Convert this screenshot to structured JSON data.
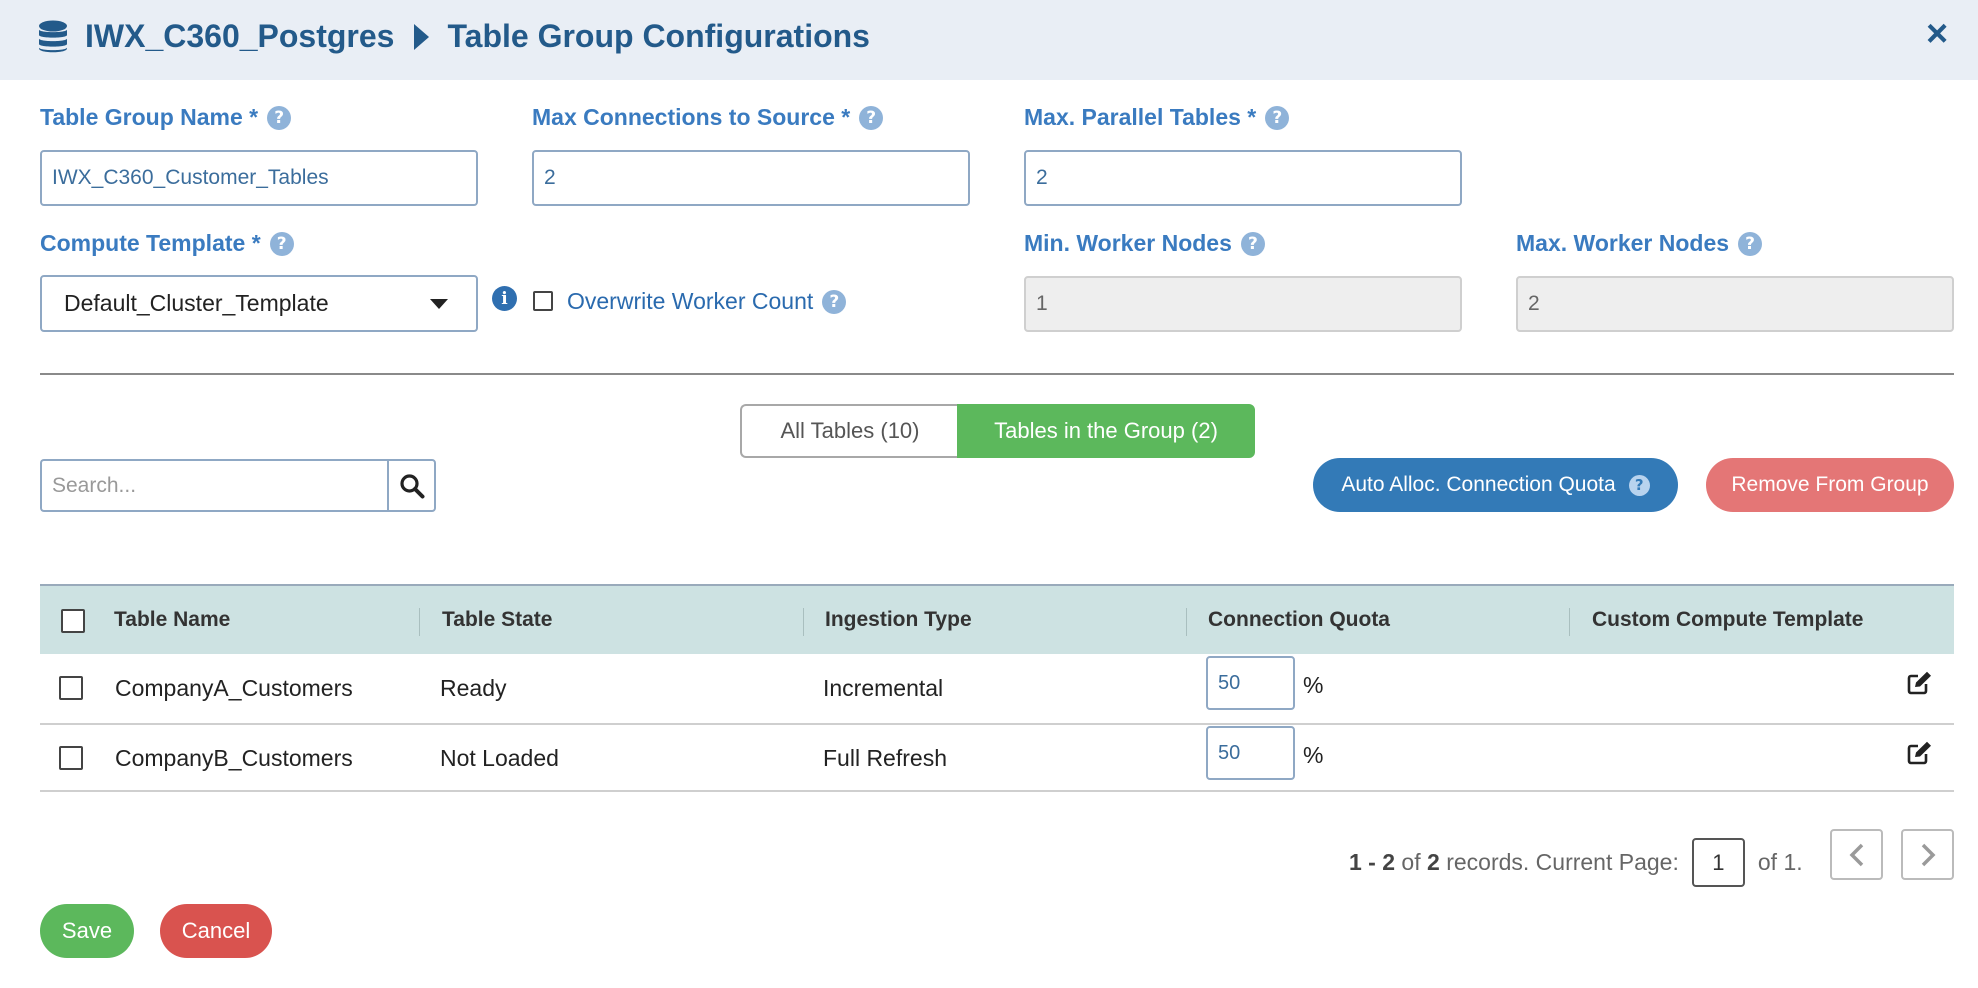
{
  "header": {
    "source_name": "IWX_C360_Postgres",
    "page_title": "Table Group Configurations",
    "close_label": "×"
  },
  "form": {
    "table_group_name": {
      "label": "Table Group Name *",
      "value": "IWX_C360_Customer_Tables"
    },
    "max_connections": {
      "label": "Max Connections to Source *",
      "value": "2"
    },
    "max_parallel_tables": {
      "label": "Max. Parallel Tables *",
      "value": "2"
    },
    "compute_template": {
      "label": "Compute Template *",
      "selected": "Default_Cluster_Template"
    },
    "overwrite_worker_count": {
      "label": "Overwrite Worker Count",
      "checked": false
    },
    "min_worker_nodes": {
      "label": "Min. Worker Nodes",
      "value": "1"
    },
    "max_worker_nodes": {
      "label": "Max. Worker Nodes",
      "value": "2"
    }
  },
  "tabs": [
    {
      "label": "All Tables (10)",
      "active": false
    },
    {
      "label": "Tables in the Group (2)",
      "active": true
    }
  ],
  "search": {
    "placeholder": "Search..."
  },
  "actions": {
    "auto_alloc_label": "Auto Alloc. Connection Quota",
    "remove_label": "Remove From Group"
  },
  "table": {
    "columns": [
      "Table Name",
      "Table State",
      "Ingestion Type",
      "Connection Quota",
      "Custom Compute Template"
    ],
    "rows": [
      {
        "name": "CompanyA_Customers",
        "state": "Ready",
        "ingestion": "Incremental",
        "quota": "50",
        "unit": "%"
      },
      {
        "name": "CompanyB_Customers",
        "state": "Not Loaded",
        "ingestion": "Full Refresh",
        "quota": "50",
        "unit": "%"
      }
    ]
  },
  "pagination": {
    "range_start": "1",
    "range_sep": " - ",
    "range_end": "2",
    "of_word": " of ",
    "total": "2",
    "records_text": " records. Current Page:",
    "current_page": "1",
    "of_pages": "of 1."
  },
  "footer": {
    "save_label": "Save",
    "cancel_label": "Cancel"
  },
  "colors": {
    "header_bg": "#e9eef5",
    "brand_blue": "#235a8a",
    "label_blue": "#3a7bc0",
    "success_green": "#5cb85c",
    "primary_blue": "#337ab7",
    "danger_red": "#d9534f",
    "remove_red": "#e47676",
    "table_header_bg": "#cde2e2"
  }
}
